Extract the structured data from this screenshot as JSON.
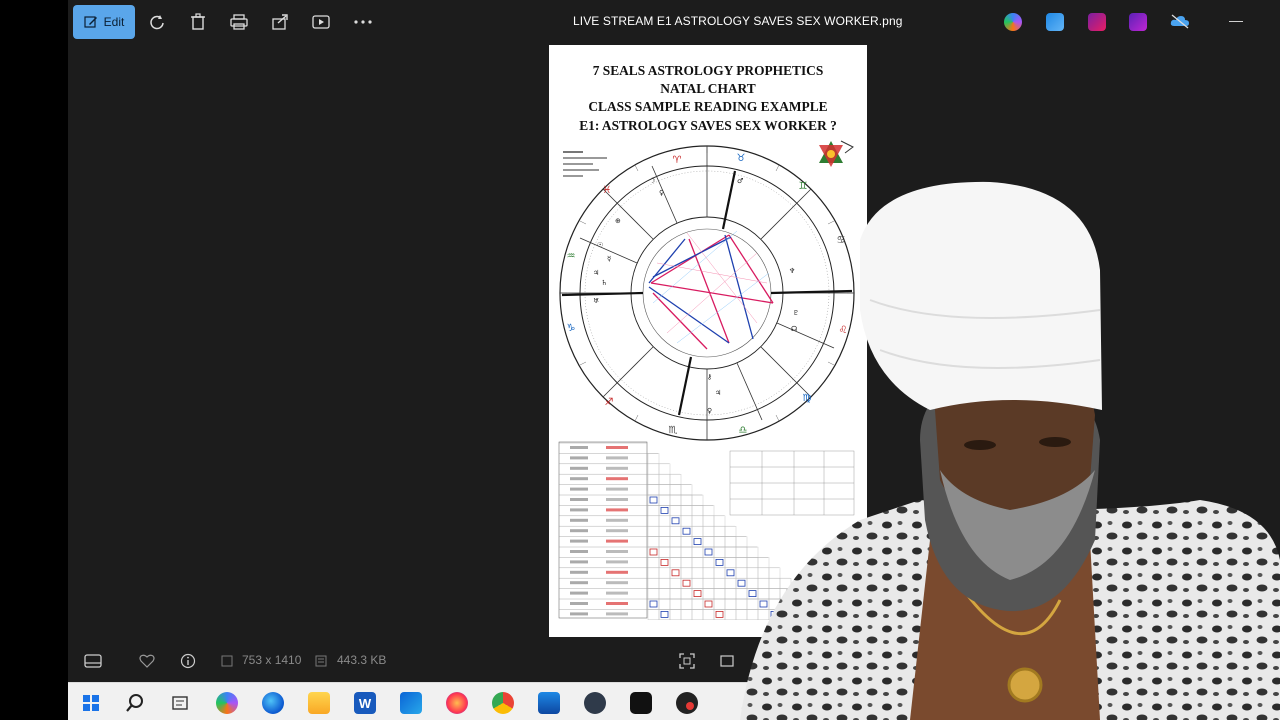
{
  "window": {
    "title": "LIVE STREAM E1 ASTROLOGY SAVES SEX WORKER.png",
    "toolbar": {
      "edit_label": "Edit",
      "icons": [
        "rotate-icon",
        "delete-icon",
        "print-icon",
        "share-icon",
        "slideshow-icon",
        "more-icon"
      ]
    },
    "app_icons": [
      "copilot-icon",
      "paint-icon",
      "clipchamp-icon",
      "designer-icon",
      "onedrive-icon"
    ],
    "accent": "#5aa6ea"
  },
  "document": {
    "title_lines": [
      "7 SEALS ASTROLOGY PROPHETICS",
      "NATAL CHART",
      "CLASS SAMPLE READING EXAMPLE",
      "E1: ASTROLOGY SAVES SEX WORKER ?"
    ]
  },
  "statusbar": {
    "dimensions": "753 x 1410",
    "file_size": "443.3 KB"
  },
  "taskbar": {
    "icons": [
      "start-icon",
      "search-icon",
      "taskview-icon",
      "copilot-icon",
      "edge-icon",
      "explorer-icon",
      "word-icon",
      "outlook-icon",
      "firefox-icon",
      "chrome-icon",
      "store-icon",
      "app-icon",
      "obs-icon",
      "record-icon"
    ]
  }
}
